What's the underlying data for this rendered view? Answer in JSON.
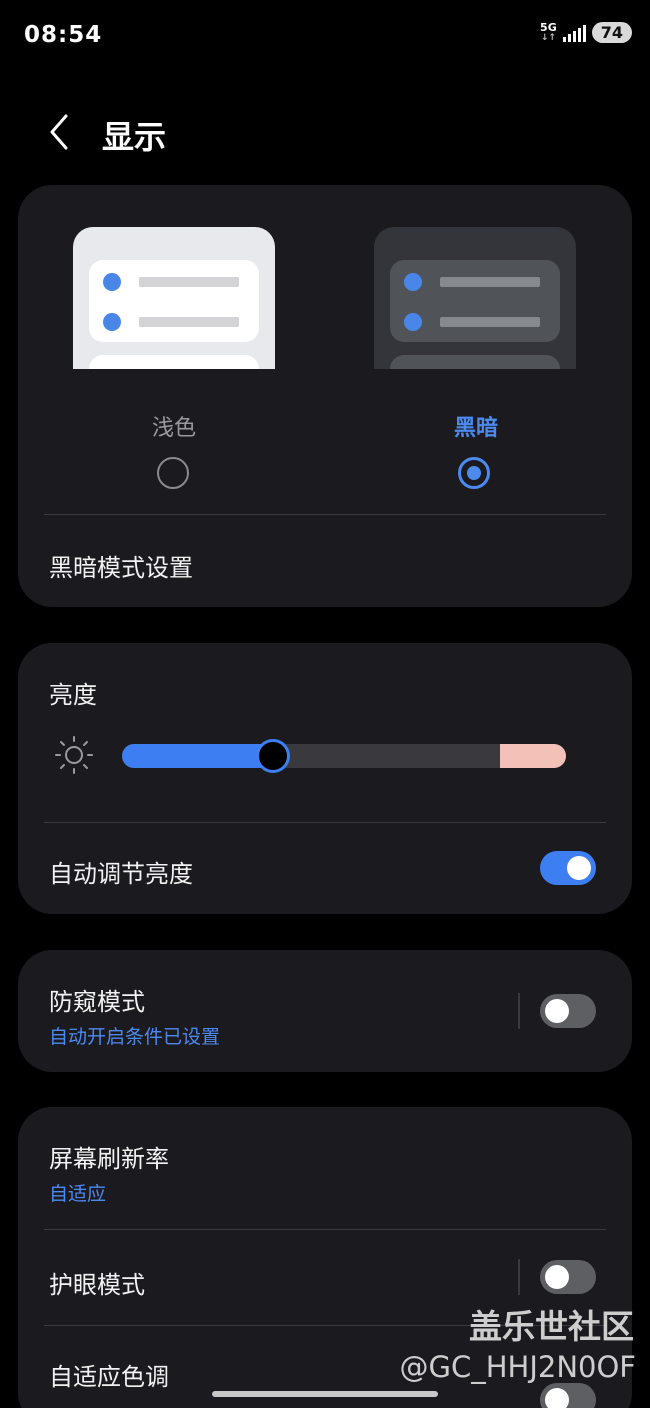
{
  "status_bar": {
    "time": "08:54",
    "network": "5G",
    "battery": "74"
  },
  "header": {
    "title": "显示",
    "back_icon": "chevron-left-icon"
  },
  "theme": {
    "light_label": "浅色",
    "dark_label": "黑暗",
    "selected": "黑暗",
    "dark_mode_settings": "黑暗模式设置"
  },
  "brightness": {
    "title": "亮度",
    "level_percent": 34,
    "auto_label": "自动调节亮度",
    "auto_enabled": true
  },
  "privacy": {
    "title": "防窥模式",
    "subtitle": "自动开启条件已设置",
    "enabled": false
  },
  "refresh": {
    "title": "屏幕刷新率",
    "subtitle": "自适应"
  },
  "eye_care": {
    "title": "护眼模式",
    "enabled": false
  },
  "adaptive_color": {
    "title": "自适应色调"
  },
  "watermark": {
    "line1": "盖乐世社区",
    "line2": "@GC_HHJ2N0OF"
  },
  "colors": {
    "accent": "#3d7ff2",
    "card": "#1b1b1f",
    "background": "#000000"
  }
}
